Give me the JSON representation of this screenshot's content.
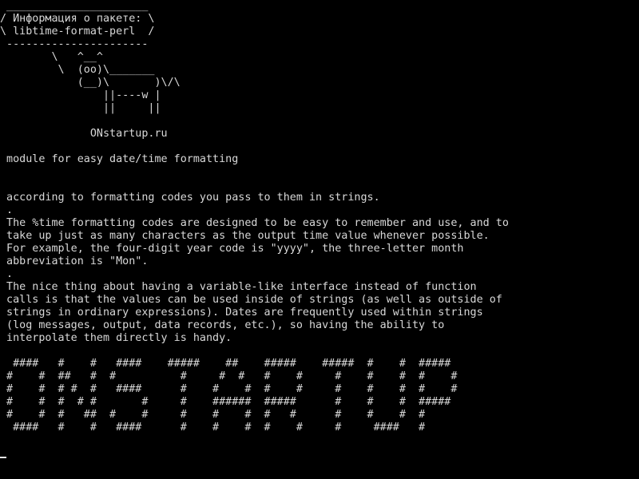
{
  "terminal": {
    "lines": [
      " ______________________",
      "/ Информация о пакете: \\",
      "\\ libtime-format-perl  /",
      " ----------------------",
      "        \\   ^__^",
      "         \\  (oo)\\_______",
      "            (__)\\       )\\/\\",
      "                ||----w |",
      "                ||     ||",
      "",
      "              ONstartup.ru",
      "",
      " module for easy date/time formatting",
      "",
      "",
      " according to formatting codes you pass to them in strings.",
      " .",
      " The %time formatting codes are designed to be easy to remember and use, and to",
      " take up just as many characters as the output time value whenever possible.",
      " For example, the four-digit year code is \"yyyy\", the three-letter month",
      " abbreviation is \"Mon\".",
      " .",
      " The nice thing about having a variable-like interface instead of function",
      " calls is that the values can be used inside of strings (as well as outside of",
      " strings in ordinary expressions). Dates are frequently used within strings",
      " (log messages, output, data records, etc.), so having the ability to",
      " interpolate them directly is handy.",
      "",
      "  ####   #    #   ####    #####    ##    #####    #####  #    #  #####",
      " #    #  ##   #  #          #     #  #   #    #     #    #    #  #    #",
      " #    #  # #  #   ####      #    #    #  #    #     #    #    #  #    #",
      " #    #  #  # #       #     #    ######  #####      #    #    #  #####",
      " #    #  #   ##  #    #     #    #    #  #   #      #    #    #  #",
      "  ####   #    #   ####      #    #    #  #    #     #     ####   #"
    ]
  }
}
